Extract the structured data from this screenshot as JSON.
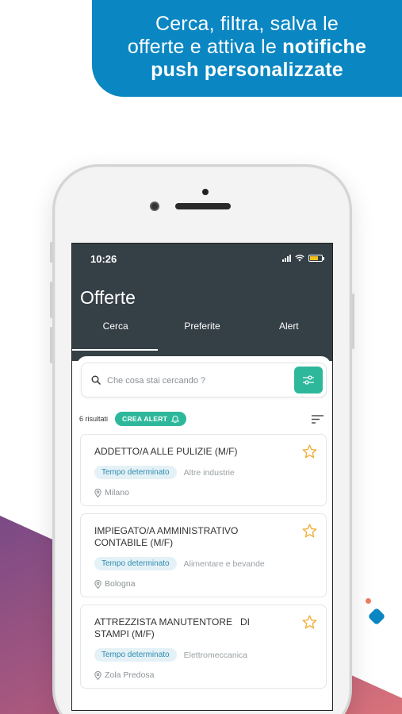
{
  "banner": {
    "line1": "Cerca, filtra, salva le",
    "line2_regular": "offerte e attiva le ",
    "line2_bold": "notifiche",
    "line3_bold": "push personalizzate"
  },
  "status_bar": {
    "time": "10:26"
  },
  "app": {
    "title": "Offerte",
    "tabs": [
      {
        "label": "Cerca",
        "active": true
      },
      {
        "label": "Preferite",
        "active": false
      },
      {
        "label": "Alert",
        "active": false
      }
    ]
  },
  "search": {
    "placeholder": "Che cosa stai cercando ?",
    "value": ""
  },
  "results": {
    "count_label": "6 risultati",
    "create_alert_label": "CREA ALERT"
  },
  "jobs": [
    {
      "title": "ADDETTO/A ALLE PULIZIE (M/F)",
      "contract": "Tempo determinato",
      "sector": "Altre industrie",
      "location": "Milano"
    },
    {
      "title": "IMPIEGATO/A AMMINISTRATIVO CONTABILE (M/F)",
      "contract": "Tempo determinato",
      "sector": "Alimentare e bevande",
      "location": "Bologna"
    },
    {
      "title": "ATTREZZISTA MANUTENTORE   DI STAMPI (M/F)",
      "contract": "Tempo determinato",
      "sector": "Elettromeccanica",
      "location": "Zola Predosa"
    }
  ],
  "colors": {
    "brand_blue": "#0a86c2",
    "topbar": "#353f46",
    "accent_green": "#2db89b",
    "star_gold": "#f0b03a",
    "tag_bg": "#e4f1f6",
    "battery_yellow": "#f2c21b"
  },
  "icons": [
    "search-icon",
    "filter-icon",
    "bell-icon",
    "sort-icon",
    "star-outline-icon",
    "location-pin-icon",
    "signal-icon",
    "wifi-icon",
    "battery-icon"
  ]
}
